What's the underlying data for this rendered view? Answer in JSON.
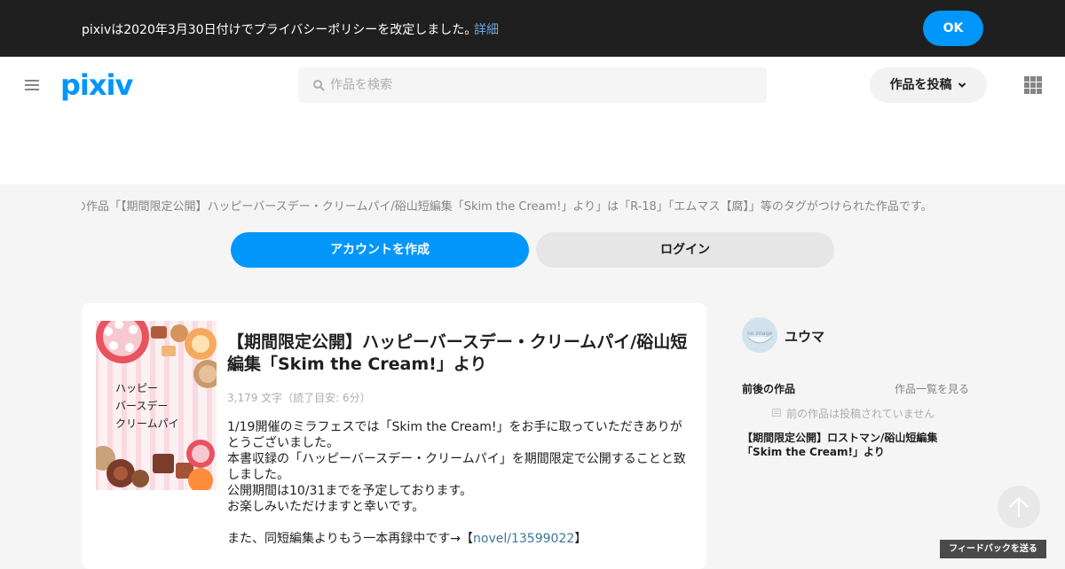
{
  "banner": {
    "text": "pixivは2020年3月30日付けでプライバシーポリシーを改定しました。",
    "link_label": "詳細",
    "ok_label": "OK"
  },
  "header": {
    "logo_text": "pixiv",
    "search_placeholder": "作品を検索",
    "post_button_label": "作品を投稿"
  },
  "promo": {
    "tagline": "の作品「【期間限定公開】ハッピーバースデー・クリームパイ/硲山短編集「Skim the Cream!」より」は「R-18」「エムマス【腐】」等のタグがつけられた作品です。",
    "create_account_label": "アカウントを作成",
    "login_label": "ログイン"
  },
  "work": {
    "cover_lines": [
      "ハッピー",
      "バースデー",
      "クリームパイ"
    ],
    "title": "【期間限定公開】ハッピーバースデー・クリームパイ/硲山短編集「Skim the Cream!」より",
    "meta": "3,179 文字（読了目安: 6分）",
    "caption": {
      "line1": "1/19開催のミラフェスでは「Skim the Cream!」をお手に取っていただきありがとうございました。",
      "line2": "本書収録の「ハッピーバースデー・クリームパイ」を期間限定で公開することと致しました。",
      "line3": "公開期間は10/31までを予定しております。",
      "line4": "お楽しみいただけますと幸いです。",
      "line5_prefix": "また、同短編集よりもう一本再録中です→【",
      "line5_link": "novel/13599022",
      "line5_suffix": "】"
    }
  },
  "sidebar": {
    "author_name": "ユウマ",
    "avatar_label": "no image",
    "nav_heading": "前後の作品",
    "nav_all_label": "作品一覧を見る",
    "no_previous": "前の作品は投稿されていません",
    "next_work_title": "【期間限定公開】ロストマン/硲山短編集「Skim the Cream!」より"
  },
  "footer": {
    "feedback_label": "フィードバックを送る"
  },
  "colors": {
    "accent": "#0096fa",
    "banner_bg": "#1f1f1f",
    "link": "#3d7699"
  }
}
